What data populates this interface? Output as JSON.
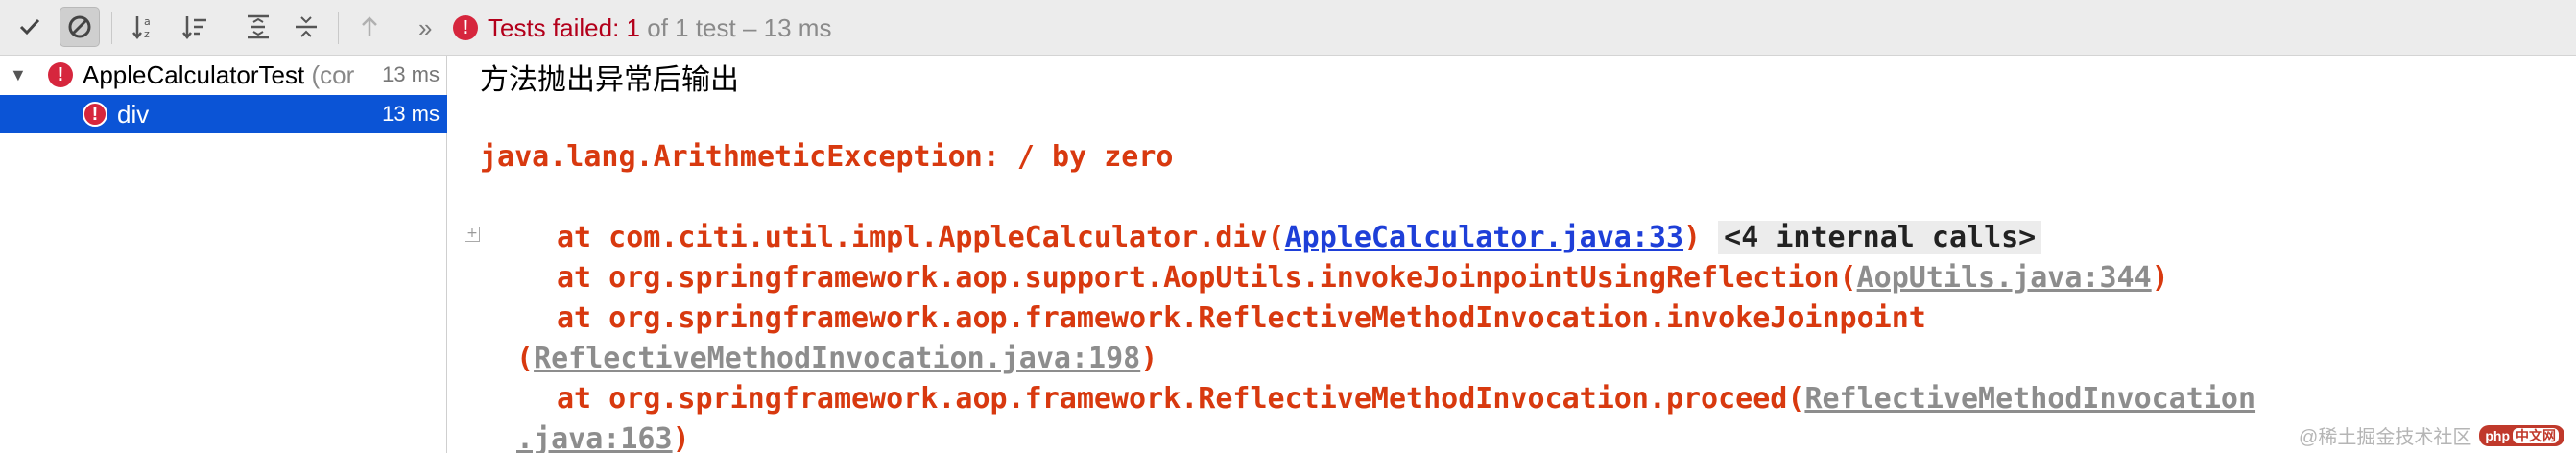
{
  "toolbar": {
    "buttons": [
      {
        "name": "show-passed-button",
        "icon": "check-icon"
      },
      {
        "name": "show-ignored-button",
        "icon": "cancel-icon"
      },
      {
        "name": "sort-alphabetically-button",
        "icon": "sort-alpha-icon"
      },
      {
        "name": "sort-by-duration-button",
        "icon": "sort-duration-icon"
      },
      {
        "name": "expand-all-button",
        "icon": "expand-all-icon"
      },
      {
        "name": "collapse-all-button",
        "icon": "collapse-all-icon"
      },
      {
        "name": "previous-failed-button",
        "icon": "arrow-up-icon"
      }
    ],
    "status": {
      "label": "Tests failed:",
      "failed_count": "1",
      "rest": "of 1 test – 13 ms"
    }
  },
  "tree": {
    "root": {
      "name": "AppleCalculatorTest",
      "suffix": "(cor",
      "time": "13 ms"
    },
    "child": {
      "name": "div",
      "time": "13 ms"
    }
  },
  "console": {
    "heading": "方法抛出异常后输出",
    "exception": "java.lang.ArithmeticException: / by zero",
    "frames": [
      {
        "prefix": "at com.citi.util.impl.AppleCalculator.div(",
        "link": "AppleCalculator.java:33",
        "suffix": ")",
        "extra": "<4 internal calls>"
      },
      {
        "prefix": "at org.springframework.aop.support.AopUtils.invokeJoinpointUsingReflection(",
        "link": "AopUtils.java:344",
        "suffix": ")"
      },
      {
        "prefix": "at org.springframework.aop.framework.ReflectiveMethodInvocation.invokeJoinpoint",
        "cont_prefix": "(",
        "link": "ReflectiveMethodInvocation.java:198",
        "suffix": ")"
      },
      {
        "prefix": "at org.springframework.aop.framework.ReflectiveMethodInvocation.proceed(",
        "link": "ReflectiveMethodInvocation",
        "cont_link": ".java:163",
        "suffix": ")"
      }
    ]
  },
  "watermark": {
    "text": "@稀土掘金技术社区",
    "logo": "php",
    "logo_tail": "中文网"
  },
  "colors": {
    "error": "#d6263d",
    "selection": "#0b54d6",
    "stack": "#d8390f",
    "link": "#1e3fd8"
  }
}
